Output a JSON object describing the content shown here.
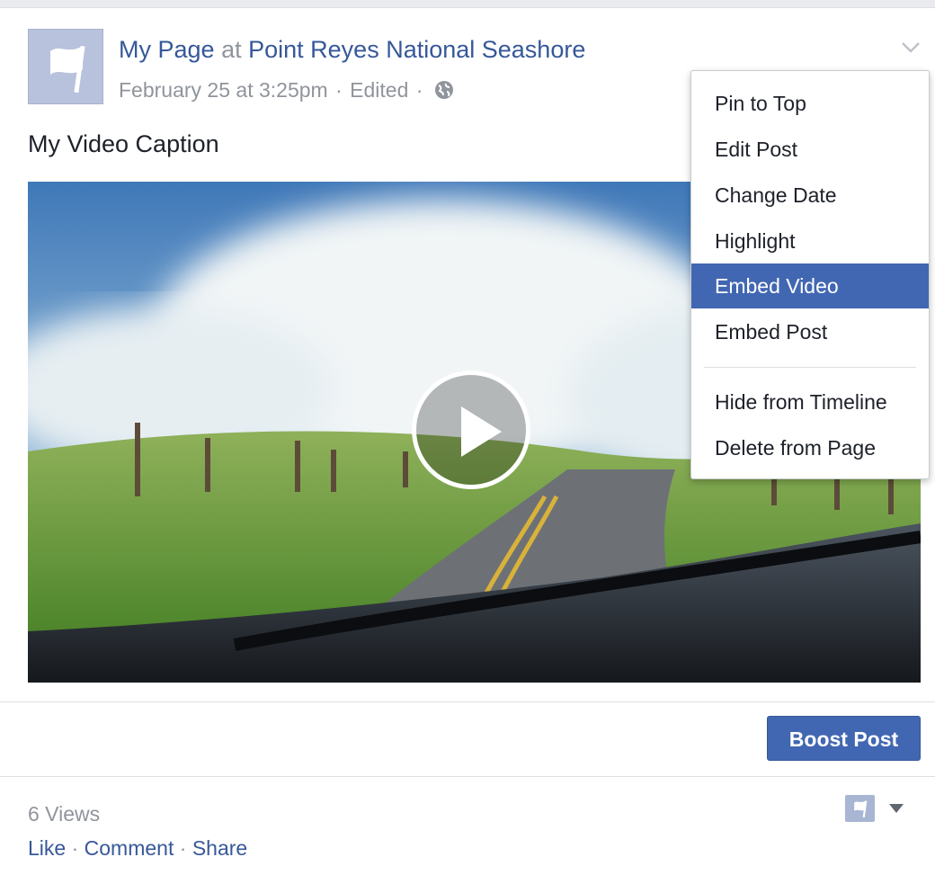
{
  "post": {
    "page_name": "My Page",
    "at_word": "at",
    "location": "Point Reyes National Seashore",
    "date": "February 25 at 3:25pm",
    "separator": "·",
    "edited": "Edited",
    "caption": "My Video Caption"
  },
  "menu": {
    "items": [
      {
        "label": "Pin to Top"
      },
      {
        "label": "Edit Post"
      },
      {
        "label": "Change Date"
      },
      {
        "label": "Highlight"
      },
      {
        "label": "Embed Video",
        "active": true
      },
      {
        "label": "Embed Post"
      },
      {
        "label": "Hide from Timeline"
      },
      {
        "label": "Delete from Page"
      }
    ]
  },
  "actions": {
    "boost_label": "Boost Post",
    "views": "6 Views",
    "like": "Like",
    "comment": "Comment",
    "share": "Share",
    "separator": "·"
  },
  "icons": {
    "avatar": "flag-icon",
    "privacy": "globe-icon",
    "options": "chevron-down-icon",
    "play": "play-icon",
    "page_selector": "flag-icon"
  },
  "colors": {
    "link": "#365899",
    "accent": "#4267b2",
    "muted": "#90949c"
  }
}
